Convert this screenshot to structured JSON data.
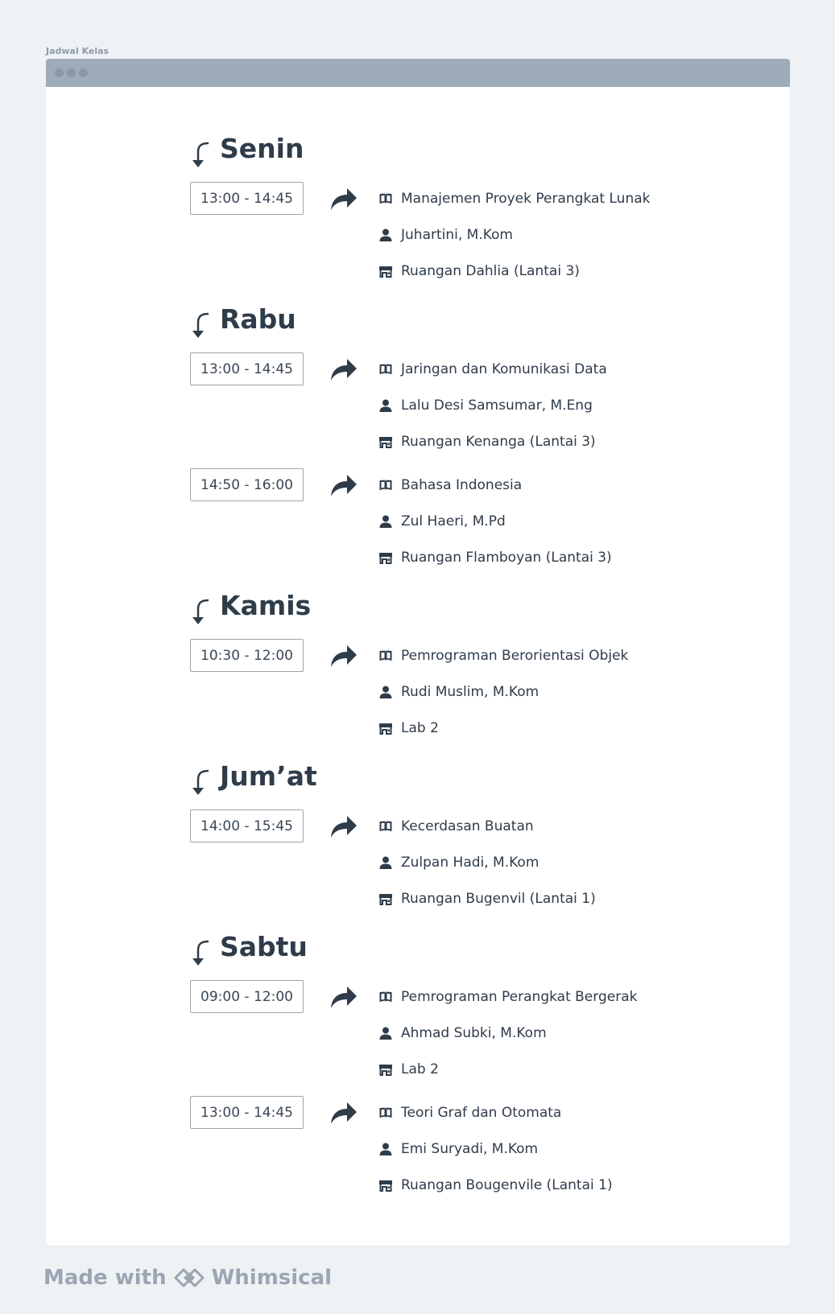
{
  "window": {
    "label": "Jadwal Kelas"
  },
  "schedule": [
    {
      "day": "Senin",
      "slots": [
        {
          "time": "13:00 - 14:45",
          "course": "Manajemen Proyek Perangkat Lunak",
          "lecturer": "Juhartini, M.Kom",
          "room": "Ruangan Dahlia (Lantai 3)"
        }
      ]
    },
    {
      "day": "Rabu",
      "slots": [
        {
          "time": "13:00 - 14:45",
          "course": "Jaringan dan Komunikasi Data",
          "lecturer": "Lalu Desi Samsumar, M.Eng",
          "room": "Ruangan Kenanga (Lantai 3)"
        },
        {
          "time": "14:50 - 16:00",
          "course": "Bahasa Indonesia",
          "lecturer": "Zul Haeri, M.Pd",
          "room": "Ruangan Flamboyan (Lantai 3)"
        }
      ]
    },
    {
      "day": "Kamis",
      "slots": [
        {
          "time": "10:30 - 12:00",
          "course": "Pemrograman Berorientasi Objek",
          "lecturer": "Rudi Muslim, M.Kom",
          "room": "Lab 2"
        }
      ]
    },
    {
      "day": "Jum’at",
      "slots": [
        {
          "time": "14:00 - 15:45",
          "course": "Kecerdasan Buatan",
          "lecturer": "Zulpan Hadi, M.Kom",
          "room": "Ruangan Bugenvil (Lantai 1)"
        }
      ]
    },
    {
      "day": "Sabtu",
      "slots": [
        {
          "time": "09:00 - 12:00",
          "course": "Pemrograman Perangkat Bergerak",
          "lecturer": "Ahmad Subki, M.Kom",
          "room": "Lab 2"
        },
        {
          "time": "13:00 - 14:45",
          "course": "Teori Graf dan Otomata",
          "lecturer": "Emi Suryadi, M.Kom",
          "room": "Ruangan Bougenvile (Lantai 1)"
        }
      ]
    }
  ],
  "footer": {
    "made_with": "Made with",
    "brand": "Whimsical"
  },
  "colors": {
    "background": "#eff2f5",
    "titlebar": "#9eacb9",
    "text": "#2f3c4a",
    "border": "#9aa5b1"
  },
  "icons": {
    "day": "curved-down-arrow-icon",
    "slot": "share-arrow-icon",
    "course": "book-icon",
    "lecturer": "user-icon",
    "room": "store-icon"
  }
}
